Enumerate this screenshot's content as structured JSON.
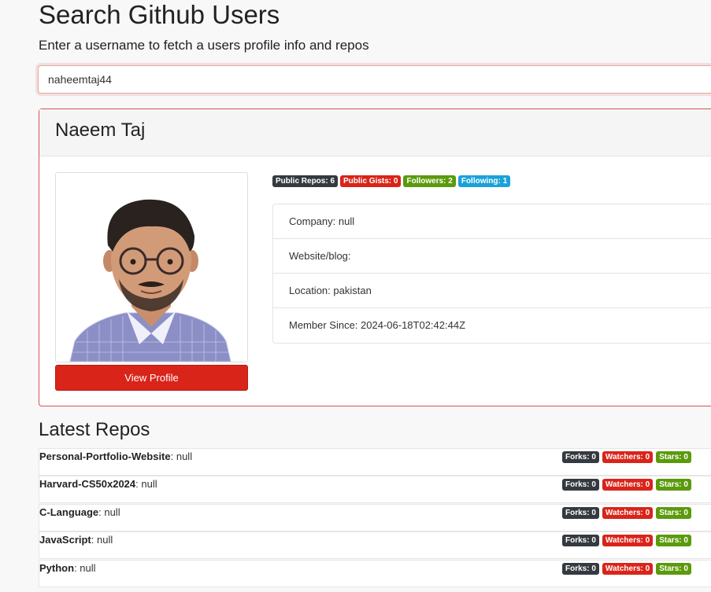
{
  "header": {
    "title": "Search Github Users",
    "subtitle": "Enter a username to fetch a users profile info and repos"
  },
  "search": {
    "value": "naheemtaj44"
  },
  "profile": {
    "name": "Naeem Taj",
    "view_profile_label": "View Profile",
    "badges": {
      "public_repos": "Public Repos: 6",
      "public_gists": "Public Gists: 0",
      "followers": "Followers: 2",
      "following": "Following: 1"
    },
    "info": {
      "company": "Company: null",
      "website": "Website/blog:",
      "location": "Location: pakistan",
      "member_since": "Member Since: 2024-06-18T02:42:44Z"
    }
  },
  "repos_section": {
    "title": "Latest Repos",
    "items": [
      {
        "name": "Personal-Portfolio-Website",
        "desc": ": null",
        "forks": "Forks: 0",
        "watchers": "Watchers: 0",
        "stars": "Stars: 0"
      },
      {
        "name": "Harvard-CS50x2024",
        "desc": ": null",
        "forks": "Forks: 0",
        "watchers": "Watchers: 0",
        "stars": "Stars: 0"
      },
      {
        "name": "C-Language",
        "desc": ": null",
        "forks": "Forks: 0",
        "watchers": "Watchers: 0",
        "stars": "Stars: 0"
      },
      {
        "name": "JavaScript",
        "desc": ": null",
        "forks": "Forks: 0",
        "watchers": "Watchers: 0",
        "stars": "Stars: 0"
      },
      {
        "name": "Python",
        "desc": ": null",
        "forks": "Forks: 0",
        "watchers": "Watchers: 0",
        "stars": "Stars: 0"
      }
    ]
  },
  "colors": {
    "accent_red": "#d9241a",
    "badge_dark": "#343a40",
    "badge_green": "#5b9a0c",
    "badge_blue": "#1ba1d9"
  }
}
